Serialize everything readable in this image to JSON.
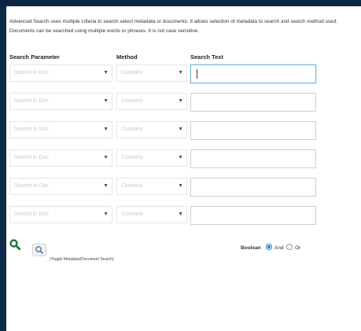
{
  "description": "Advanced Search uses multiple criteria to search select metadata or documents. It allows selection of metadata to search and search method used. Documents can be searched using multiple words or phrases. It is not case sensitive.",
  "headers": {
    "param": "Search Parameter",
    "method": "Method",
    "text": "Search Text"
  },
  "rows": [
    {
      "param": "Search in Doc",
      "method": "Contains",
      "text": ""
    },
    {
      "param": "Search in Doc",
      "method": "Contains",
      "text": ""
    },
    {
      "param": "Search in Doc",
      "method": "Contains",
      "text": ""
    },
    {
      "param": "Search in Doc",
      "method": "Contains",
      "text": ""
    },
    {
      "param": "Search in Doc",
      "method": "Contains",
      "text": ""
    },
    {
      "param": "Search in Doc",
      "method": "Contains",
      "text": ""
    }
  ],
  "toggle_label": "(Toggle Metadata/Document Search)",
  "boolean": {
    "label": "Boolean",
    "option_and": "And",
    "option_or": "Or",
    "selected": "And"
  },
  "colors": {
    "background": "#0d2a4a",
    "search_icon": "#1c7a3c",
    "radio_selected": "#2a7fd1"
  },
  "icons": {
    "search": "magnifier",
    "toggle": "magnifier-small",
    "dropdown": "triangle-down"
  }
}
